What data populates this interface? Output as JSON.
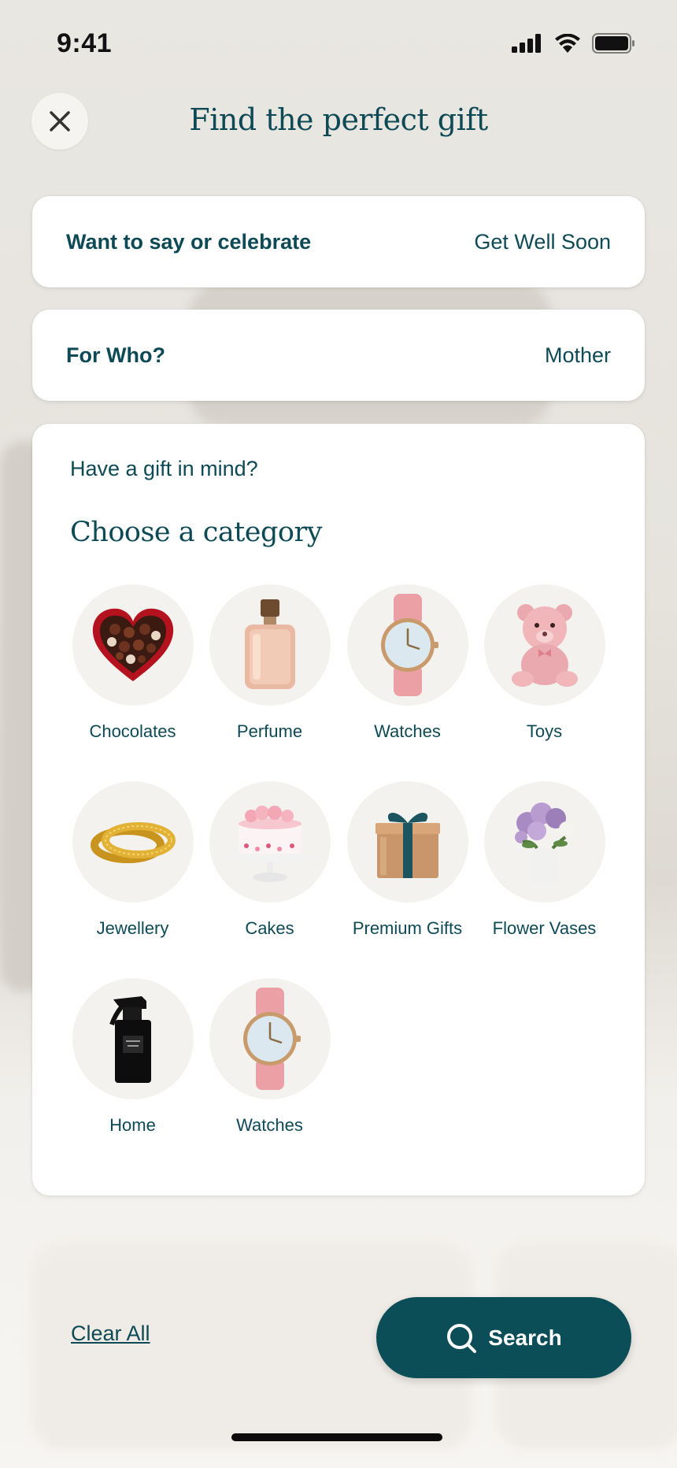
{
  "status_bar": {
    "time": "9:41"
  },
  "header": {
    "title": "Find the perfect gift"
  },
  "occasion": {
    "label": "Want to say or celebrate",
    "value": "Get Well Soon"
  },
  "recipient": {
    "label": "For Who?",
    "value": "Mother"
  },
  "categories": {
    "hint": "Have a gift in mind?",
    "title": "Choose a category",
    "items": [
      {
        "label": "Chocolates",
        "icon": "chocolate-heart-icon"
      },
      {
        "label": "Perfume",
        "icon": "perfume-bottle-icon"
      },
      {
        "label": "Watches",
        "icon": "watch-icon"
      },
      {
        "label": "Toys",
        "icon": "teddy-bear-icon"
      },
      {
        "label": "Jewellery",
        "icon": "bangles-icon"
      },
      {
        "label": "Cakes",
        "icon": "cake-icon"
      },
      {
        "label": "Premium Gifts",
        "icon": "gift-box-icon"
      },
      {
        "label": "Flower Vases",
        "icon": "flower-vase-icon"
      },
      {
        "label": "Home",
        "icon": "room-spray-icon"
      },
      {
        "label": "Watches",
        "icon": "watch-icon"
      }
    ]
  },
  "footer": {
    "clear_label": "Clear All",
    "search_label": "Search"
  },
  "colors": {
    "primary": "#0b4e58",
    "text": "#0e4a55",
    "circle_bg": "#f4f2ee"
  }
}
